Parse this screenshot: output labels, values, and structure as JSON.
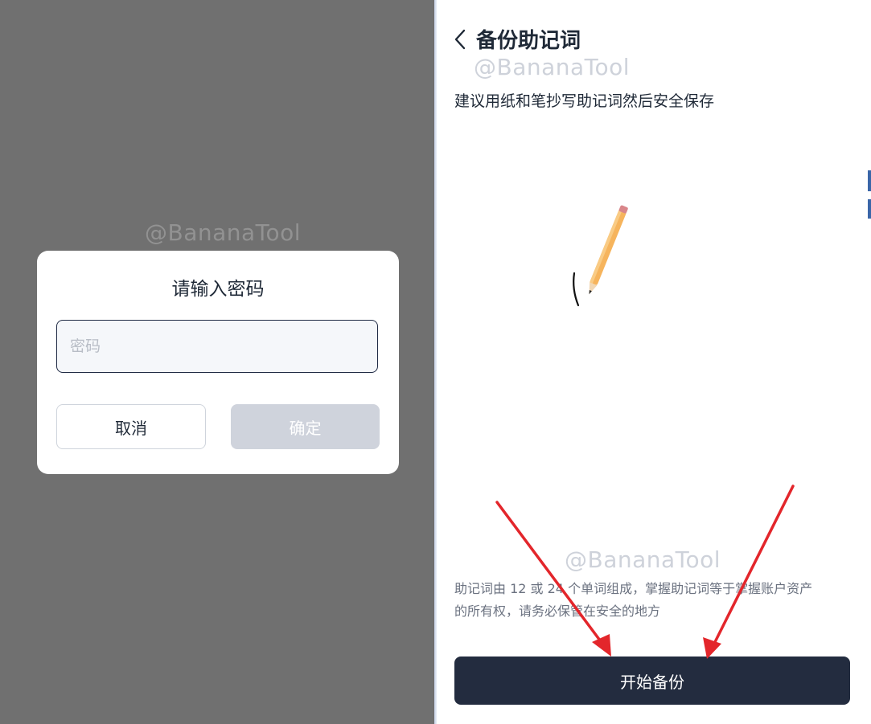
{
  "left_pane": {
    "watermark": "@BananaTool"
  },
  "password_dialog": {
    "title": "请输入密码",
    "input_placeholder": "密码",
    "input_value": "",
    "cancel_label": "取消",
    "confirm_label": "确定"
  },
  "backup_page": {
    "back_icon": "chevron-left-icon",
    "title": "备份助记词",
    "watermark_top": "@BananaTool",
    "subtitle": "建议用纸和笔抄写助记词然后安全保存",
    "illustration_icon": "pencil-icon",
    "watermark_bottom": "@BananaTool",
    "notice_line1": "助记词由 12 或 24 个单词组成，掌握助记词等于掌握账户资产",
    "notice_line2": "的所有权，请务必保管在安全的地方",
    "start_button_label": "开始备份"
  },
  "colors": {
    "overlay": "#707070",
    "primary_button": "#232c3f",
    "disabled_button": "#cfd3dc",
    "annotation_arrow": "#e3262b"
  }
}
